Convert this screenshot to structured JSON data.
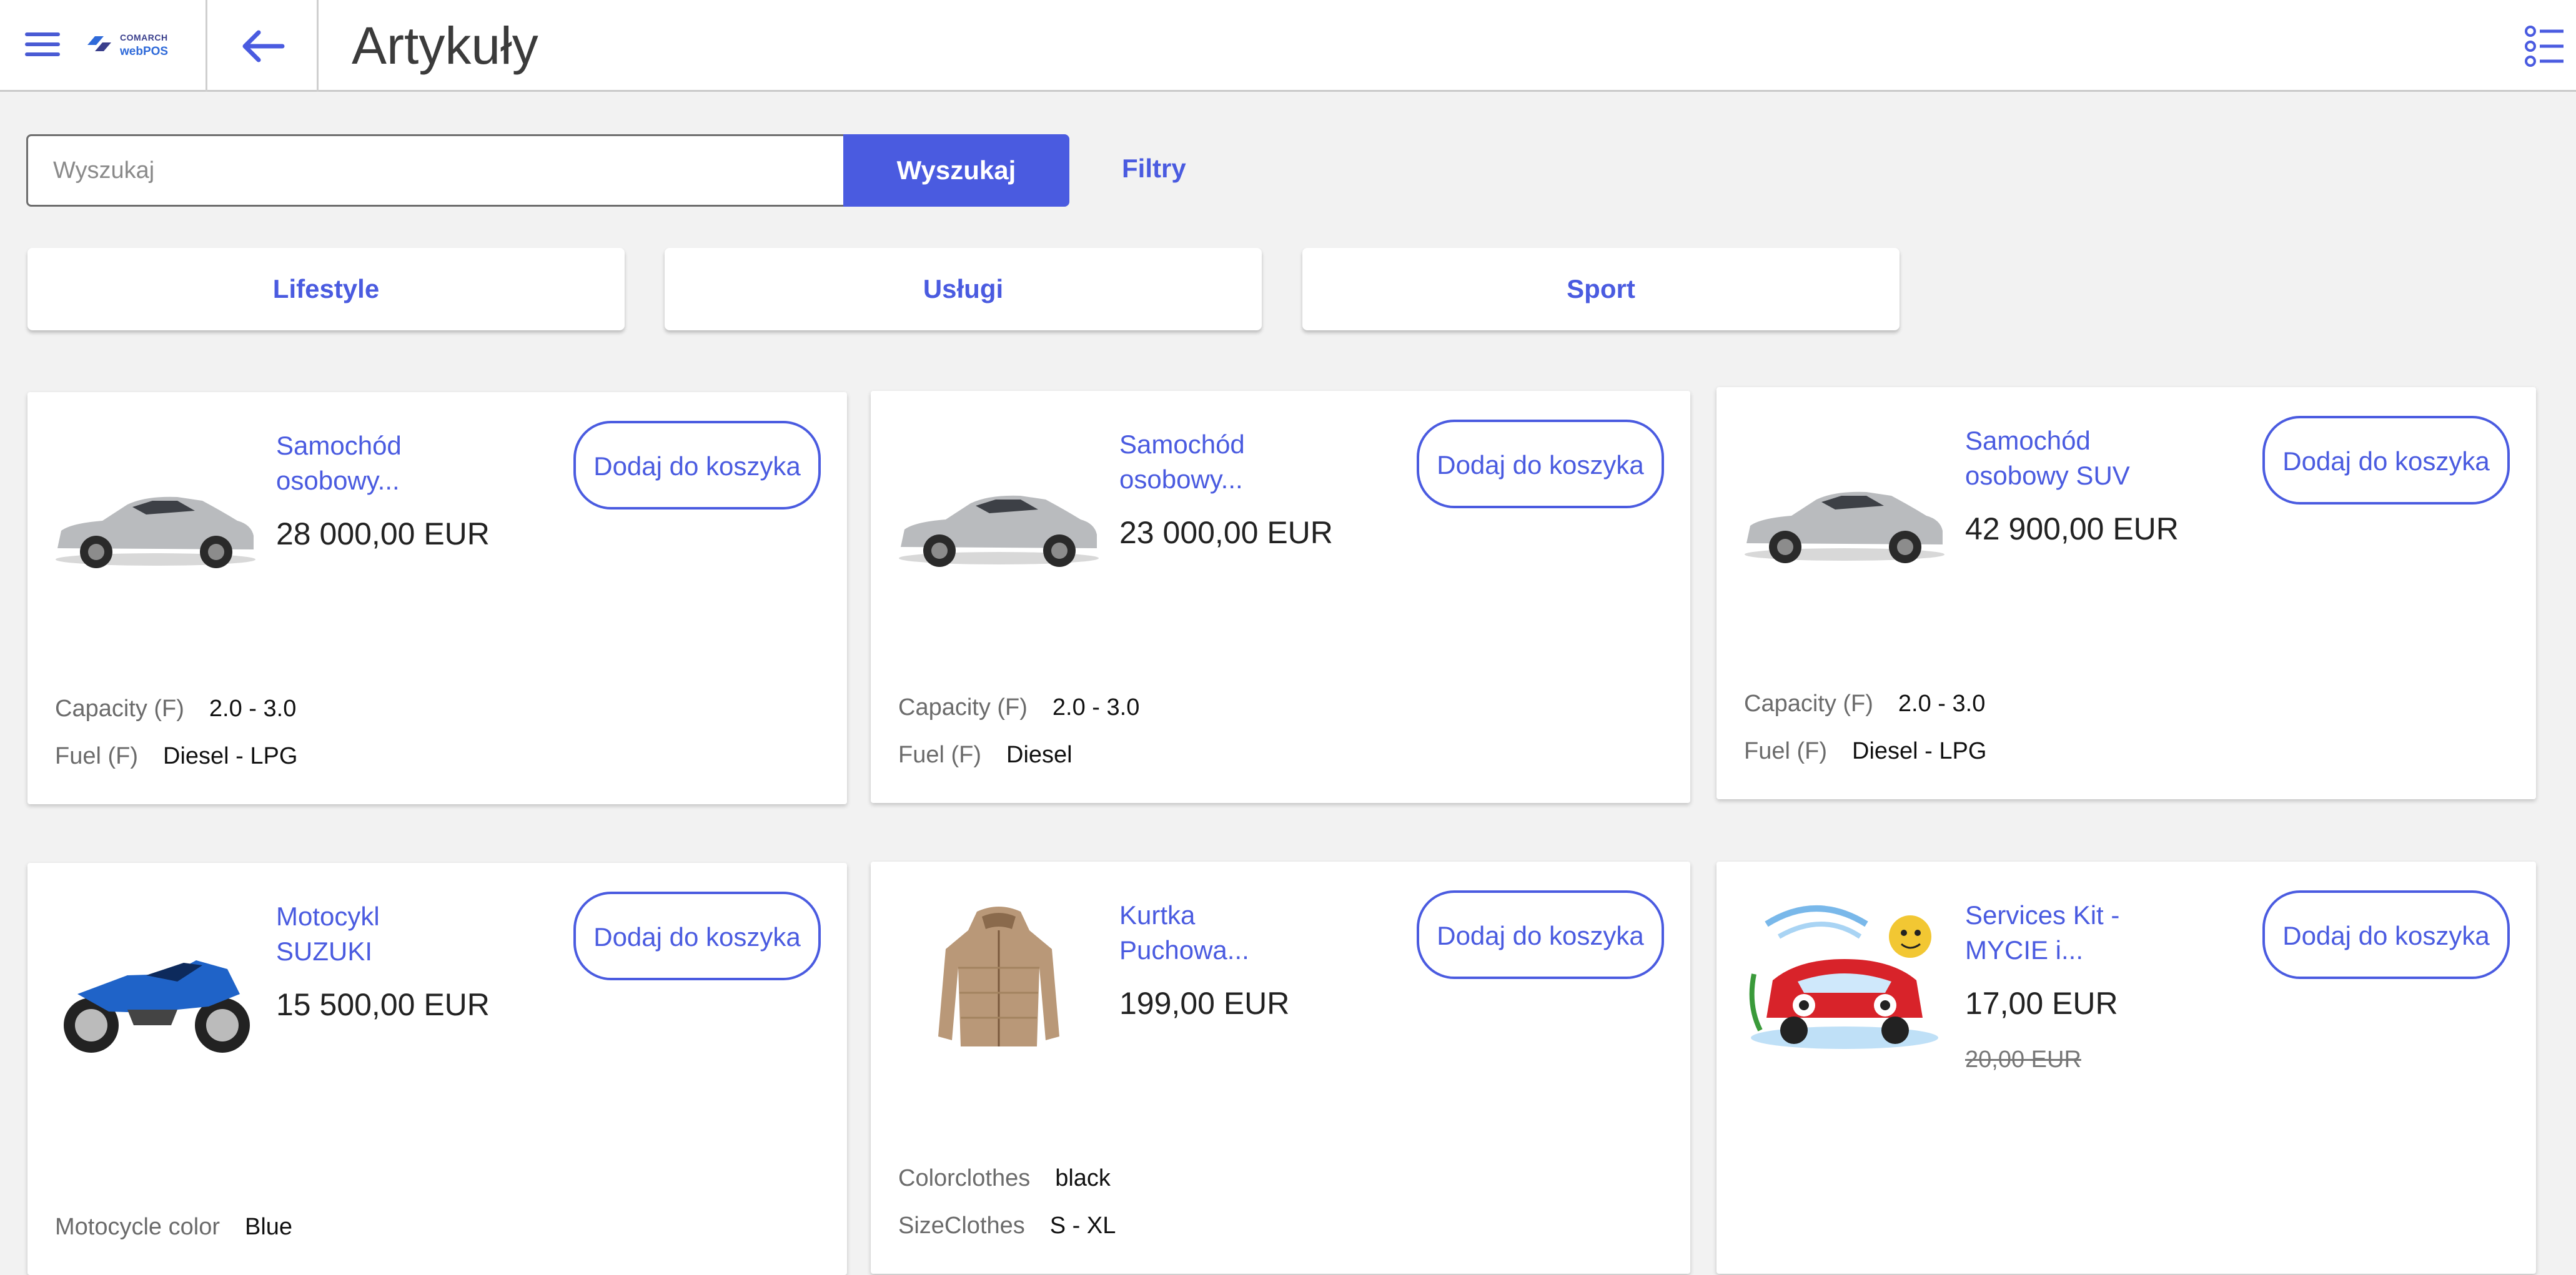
{
  "app": {
    "logo_line1": "COMARCH",
    "logo_line2": "webPOS",
    "title": "Artykuły"
  },
  "search": {
    "placeholder": "Wyszukaj",
    "value": "",
    "button_label": "Wyszukaj",
    "filters_label": "Filtry"
  },
  "categories": [
    "Lifestyle",
    "Usługi",
    "Sport"
  ],
  "add_label": "Dodaj do koszyka",
  "products": [
    {
      "name": "Samochód osobowy...",
      "price": "28 000,00 EUR",
      "image": "car-silver-sedan",
      "attributes": [
        {
          "key": "Capacity (F)",
          "value": "2.0 - 3.0"
        },
        {
          "key": "Fuel (F)",
          "value": "Diesel - LPG"
        }
      ]
    },
    {
      "name": "Samochód osobowy...",
      "price": "23 000,00 EUR",
      "image": "car-silver-sedan",
      "attributes": [
        {
          "key": "Capacity (F)",
          "value": "2.0 - 3.0"
        },
        {
          "key": "Fuel (F)",
          "value": "Diesel"
        }
      ]
    },
    {
      "name": "Samochód osobowy SUV",
      "price": "42 900,00 EUR",
      "image": "car-silver-sedan",
      "attributes": [
        {
          "key": "Capacity (F)",
          "value": "2.0 - 3.0"
        },
        {
          "key": "Fuel (F)",
          "value": "Diesel - LPG"
        }
      ]
    },
    {
      "name": "Motocykl SUZUKI",
      "price": "15 500,00 EUR",
      "image": "motorcycle-blue",
      "attributes": [
        {
          "key": "Motocycle color",
          "value": "Blue"
        }
      ]
    },
    {
      "name": "Kurtka Puchowa...",
      "price": "199,00 EUR",
      "image": "down-jacket-beige",
      "attributes": [
        {
          "key": "Colorclothes",
          "value": "black"
        },
        {
          "key": "SizeClothes",
          "value": "S - XL"
        }
      ]
    },
    {
      "name": "Services Kit - MYCIE i...",
      "price": "17,00 EUR",
      "old_price": "20,00 EUR",
      "image": "car-wash-cartoon",
      "attributes": []
    }
  ],
  "colors": {
    "accent": "#4a5be0",
    "background": "#f2f2f2",
    "card": "#ffffff"
  }
}
